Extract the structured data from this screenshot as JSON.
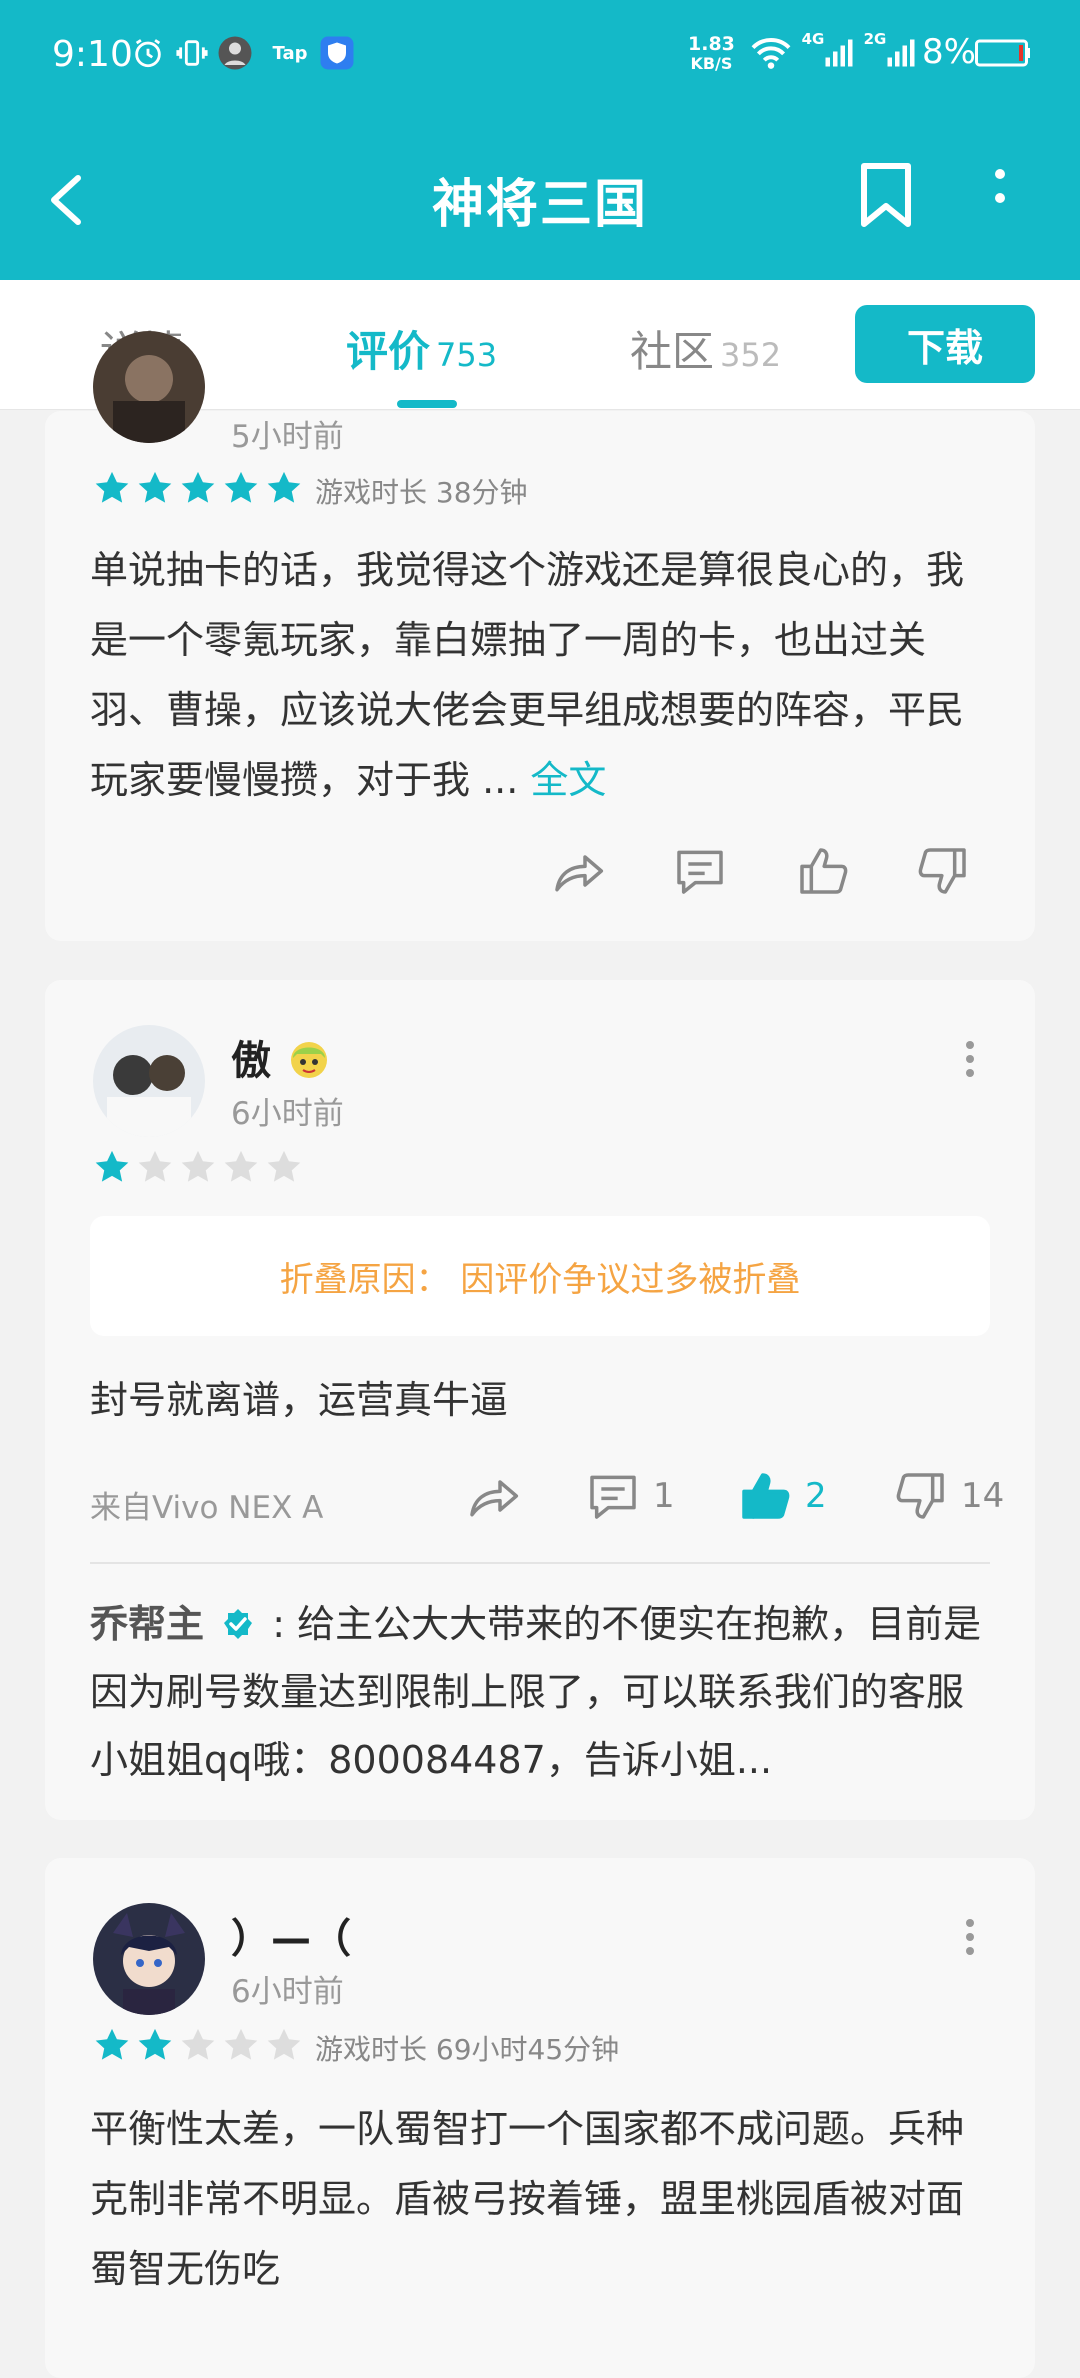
{
  "status_bar": {
    "time": "9:10",
    "net_speed_value": "1.83",
    "net_speed_unit": "KB/S",
    "network_4g": "4G",
    "network_2g": "2G",
    "tap_label": "Tap",
    "battery": "8%"
  },
  "app_bar": {
    "title": "神将三国"
  },
  "tabs": [
    {
      "label": "详情",
      "count": ""
    },
    {
      "label": "评价",
      "count": "753"
    },
    {
      "label": "社区",
      "count": "352"
    }
  ],
  "download_label": "下载",
  "reviews": [
    {
      "time_ago": "5小时前",
      "rating": 5,
      "playtime": "游戏时长 38分钟",
      "body": "单说抽卡的话，我觉得这个游戏还是算很良心的，我是一个零氪玩家，靠白嫖抽了一周的卡，也出过关羽、曹操，应该说大佬会更早组成想要的阵容，平民玩家要慢慢攒，对于我 ...",
      "full_text_link": "全文"
    },
    {
      "username": "傲",
      "time_ago": "6小时前",
      "rating": 1,
      "fold_reason": "折叠原因：  因评价争议过多被折叠",
      "body": "封号就离谱，运营真牛逼",
      "source": "来自Vivo NEX A",
      "comment_count": "1",
      "like_count": "2",
      "dislike_count": "14",
      "reply": {
        "author": "乔帮主",
        "text": ": 给主公大大带来的不便实在抱歉，目前是因为刷号数量达到限制上限了，可以联系我们的客服小姐姐qq哦：800084487，告诉小姐..."
      }
    },
    {
      "username": "）—（",
      "time_ago": "6小时前",
      "rating": 2,
      "playtime": "游戏时长 69小时45分钟",
      "body": "平衡性太差，一队蜀智打一个国家都不成问题。兵种克制非常不明显。盾被弓按着锤，盟里桃园盾被对面蜀智无伤吃"
    }
  ],
  "colors": {
    "accent": "#14b9c8",
    "fold_text": "#f5a443",
    "star_empty": "#dddddd"
  }
}
